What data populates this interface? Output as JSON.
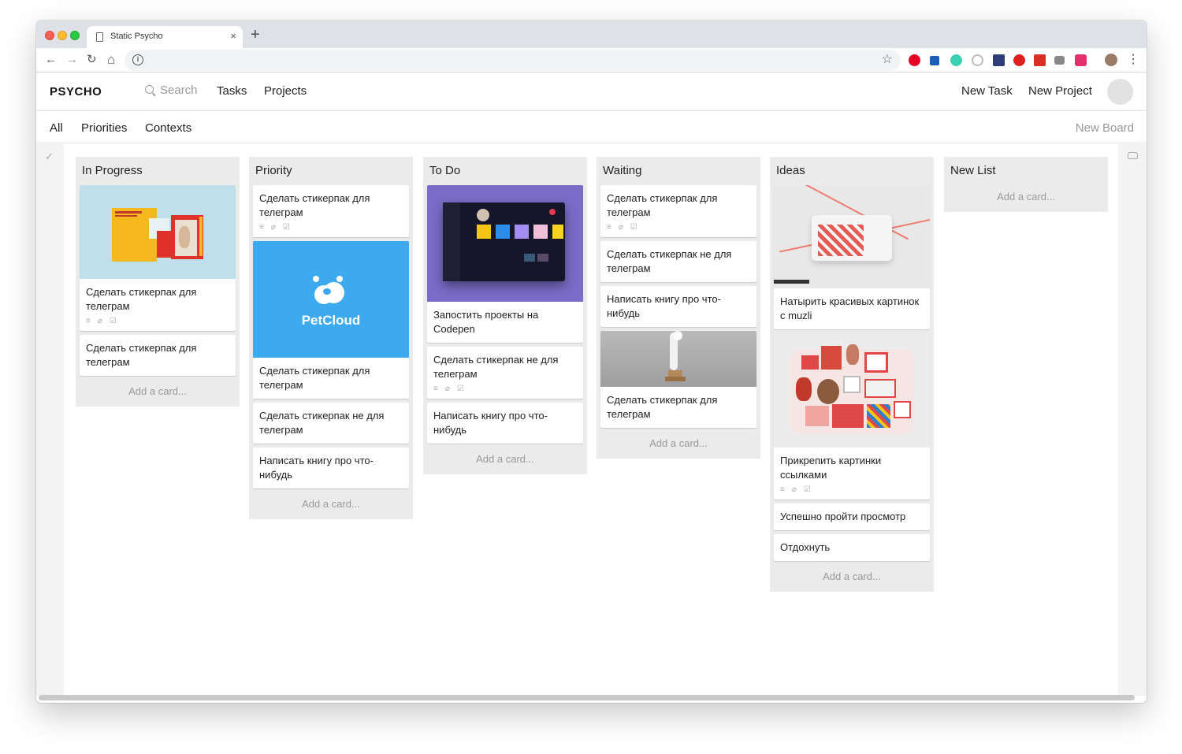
{
  "browser": {
    "tab_title": "Static Psycho",
    "tab_close": "×",
    "new_tab": "+",
    "back": "←",
    "forward": "→",
    "reload": "↻",
    "home": "⌂",
    "info": "i",
    "bookmark_star": "☆",
    "menu": "⋮"
  },
  "app": {
    "logo": "PSYCHO",
    "search_label": "Search",
    "nav_tasks": "Tasks",
    "nav_projects": "Projects",
    "new_task": "New Task",
    "new_project": "New Project"
  },
  "filters": {
    "all": "All",
    "priorities": "Priorities",
    "contexts": "Contexts",
    "new_board": "New Board"
  },
  "icons": {
    "rail_check": "✓",
    "desc": "≡",
    "attach": "⌀",
    "checklist": "☑"
  },
  "lists": [
    {
      "title": "In Progress",
      "add": "Add a card...",
      "cards": [
        {
          "text": "Сделать стикерпак для телеграм"
        },
        {
          "text": "Сделать стикерпак для телеграм"
        }
      ]
    },
    {
      "title": "Priority",
      "add": "Add a card...",
      "cards": [
        {
          "text": "Сделать стикерпак для телеграм"
        },
        {
          "text": "Сделать стикерпак для телеграм",
          "cover_label": "PetCloud"
        },
        {
          "text": "Сделать стикерпак не для телеграм"
        },
        {
          "text": "Написать книгу про что-нибудь"
        }
      ]
    },
    {
      "title": "To Do",
      "add": "Add a card...",
      "cards": [
        {
          "text": "Запостить проекты на Codepen"
        },
        {
          "text": "Сделать стикерпак не для телеграм"
        },
        {
          "text": "Написать книгу про что-нибудь"
        }
      ]
    },
    {
      "title": "Waiting",
      "add": "Add a card...",
      "cards": [
        {
          "text": "Сделать стикерпак для телеграм"
        },
        {
          "text": "Сделать стикерпак не для телеграм"
        },
        {
          "text": "Написать книгу про что-нибудь"
        },
        {
          "text": "Сделать стикерпак для телеграм"
        }
      ]
    },
    {
      "title": "Ideas",
      "add": "Add a card...",
      "cards": [
        {
          "text": "Натырить красивых картинок с muzli"
        },
        {
          "text": "Прикрепить картинки ссылками"
        },
        {
          "text": "Успешно пройти просмотр"
        },
        {
          "text": "Отдохнуть"
        }
      ]
    },
    {
      "title": "New List",
      "add": "Add a card..."
    }
  ],
  "colors": {
    "list_bg": "#ebebeb",
    "petcloud_blue": "#3da9ee",
    "codepen_purple": "#7a6cc7",
    "telegram_cover_bg": "#bfe0ea"
  }
}
